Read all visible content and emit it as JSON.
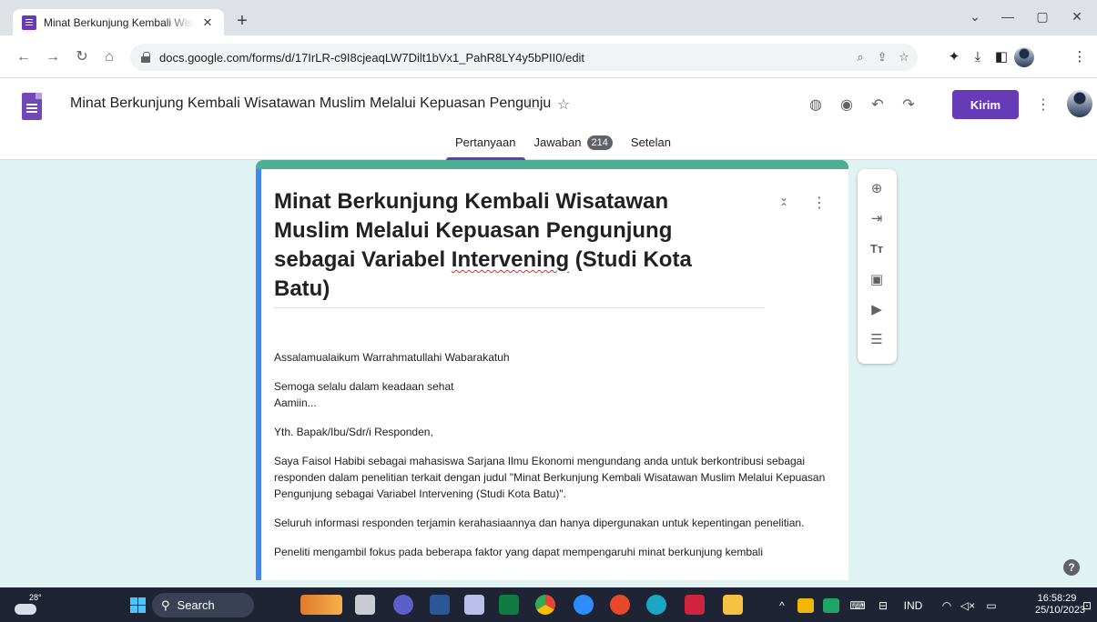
{
  "browser": {
    "tab_title": "Minat Berkunjung Kembali Wisatawan",
    "tab_close": "✕",
    "new_tab": "+",
    "url": "docs.google.com/forms/d/17IrLR-c9I8cjeaqLW7Dilt1bVx1_PahR8LY4y5bPII0/edit"
  },
  "forms_header": {
    "title": "Minat Berkunjung Kembali Wisatawan Muslim Melalui Kepuasan Pengunju",
    "send_label": "Kirim",
    "tabs": [
      {
        "label": "Pertanyaan"
      },
      {
        "label": "Jawaban",
        "badge": "214"
      },
      {
        "label": "Setelan"
      }
    ]
  },
  "form": {
    "title_before": "Minat Berkunjung Kembali Wisatawan Muslim Melalui Kepuasan Pengunjung sebagai Variabel ",
    "title_spell": "Intervening",
    "title_after": " (Studi Kota Batu)",
    "description": [
      "Assalamualaikum Warrahmatullahi Wabarakatuh",
      "Semoga selalu dalam keadaan sehat\nAamiin...",
      "Yth. Bapak/Ibu/Sdr/i Responden,",
      "Saya Faisol Habibi sebagai mahasiswa Sarjana Ilmu Ekonomi mengundang anda untuk berkontribusi sebagai responden dalam penelitian terkait dengan judul \"Minat Berkunjung Kembali Wisatawan Muslim Melalui Kepuasan Pengunjung sebagai Variabel Intervening (Studi Kota Batu)\".",
      "Seluruh informasi responden terjamin kerahasiaannya dan hanya dipergunakan untuk kepentingan penelitian.",
      "Peneliti mengambil fokus pada beberapa faktor yang dapat mempengaruhi minat berkunjung kembali"
    ]
  },
  "taskbar": {
    "weather_temp": "28°",
    "search_label": "Search",
    "language": "IND",
    "time": "16:58:29",
    "date": "25/10/2023"
  },
  "colors": {
    "accent": "#673ab7",
    "header_band": "#4caf93",
    "background": "#e0f2f1",
    "description_bar": "#4285f4"
  }
}
